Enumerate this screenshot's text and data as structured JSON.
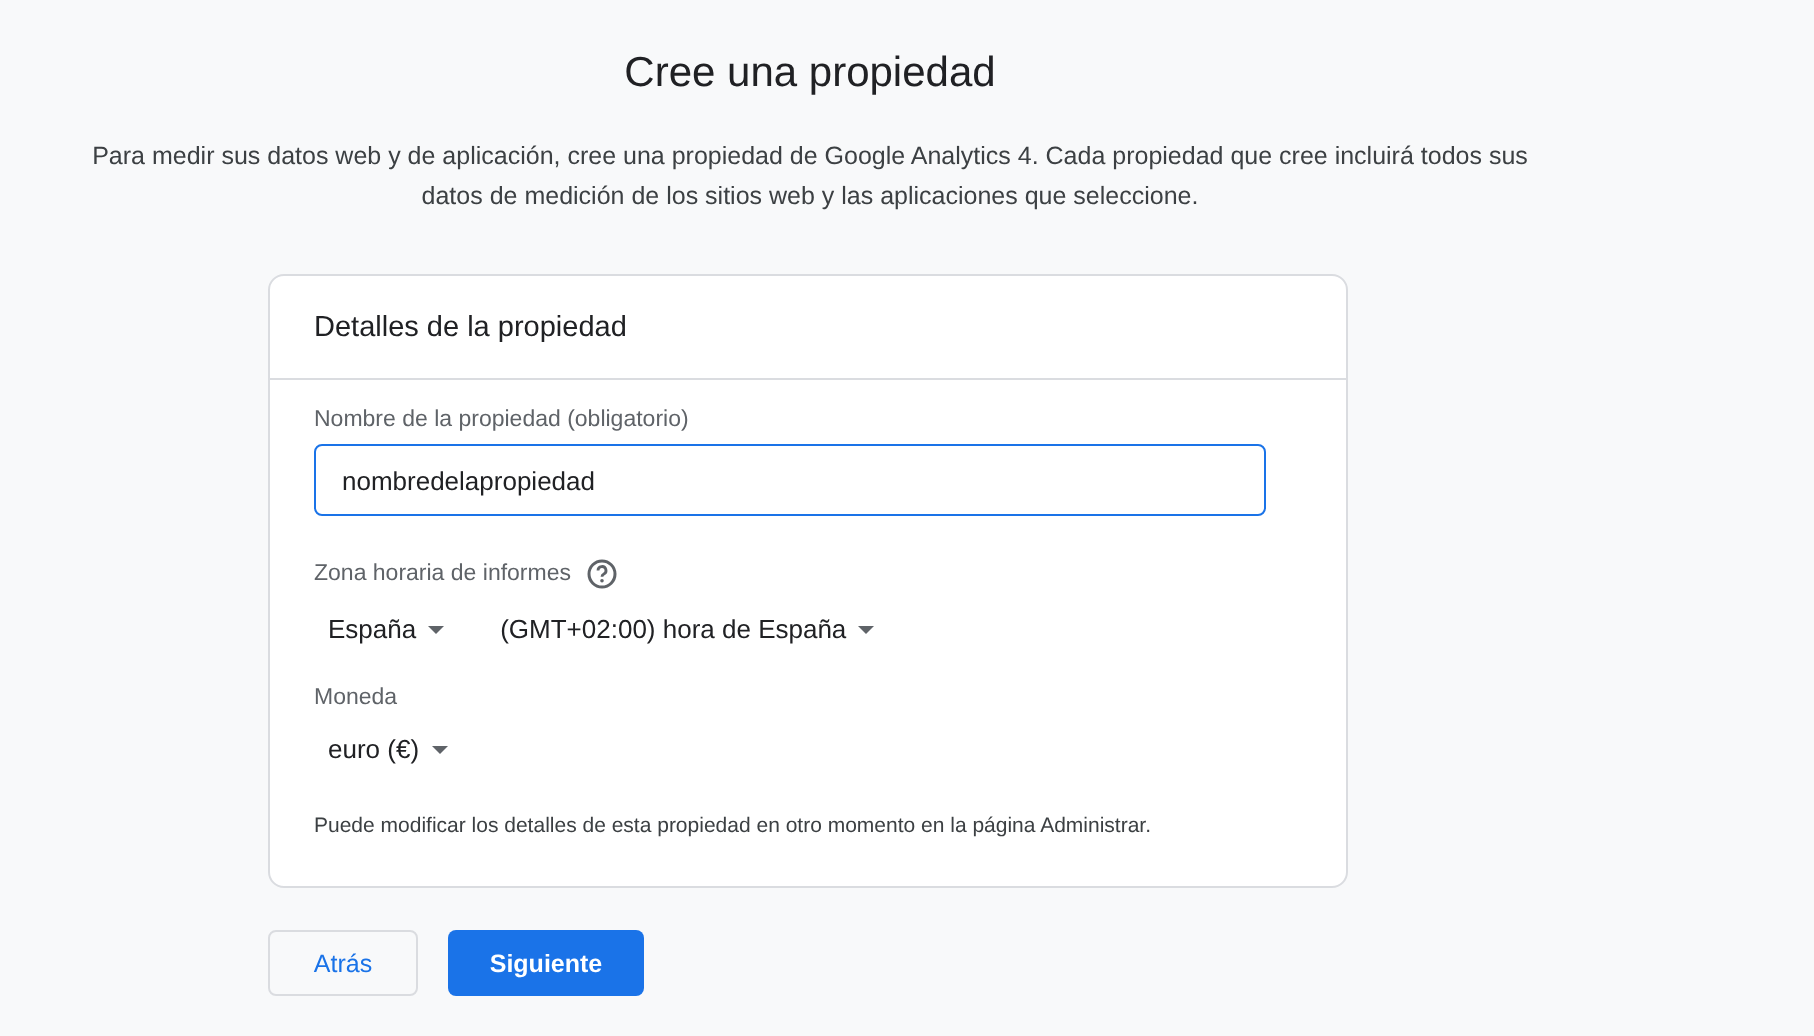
{
  "title": "Cree una propiedad",
  "description": "Para medir sus datos web y de aplicación, cree una propiedad de Google Analytics 4. Cada propiedad que cree incluirá todos sus datos de medición de los sitios web y las aplicaciones que seleccione.",
  "card": {
    "heading": "Detalles de la propiedad",
    "name_field": {
      "label": "Nombre de la propiedad (obligatorio)",
      "value": "nombredelapropiedad"
    },
    "timezone": {
      "label": "Zona horaria de informes",
      "country": "España",
      "zone": "(GMT+02:00) hora de España"
    },
    "currency": {
      "label": "Moneda",
      "value": "euro (€)"
    },
    "note": "Puede modificar los detalles de esta propiedad en otro momento en la página Administrar."
  },
  "buttons": [
    {
      "label": "Atrás",
      "kind": "secondary"
    },
    {
      "label": "Siguiente",
      "kind": "primary"
    }
  ]
}
